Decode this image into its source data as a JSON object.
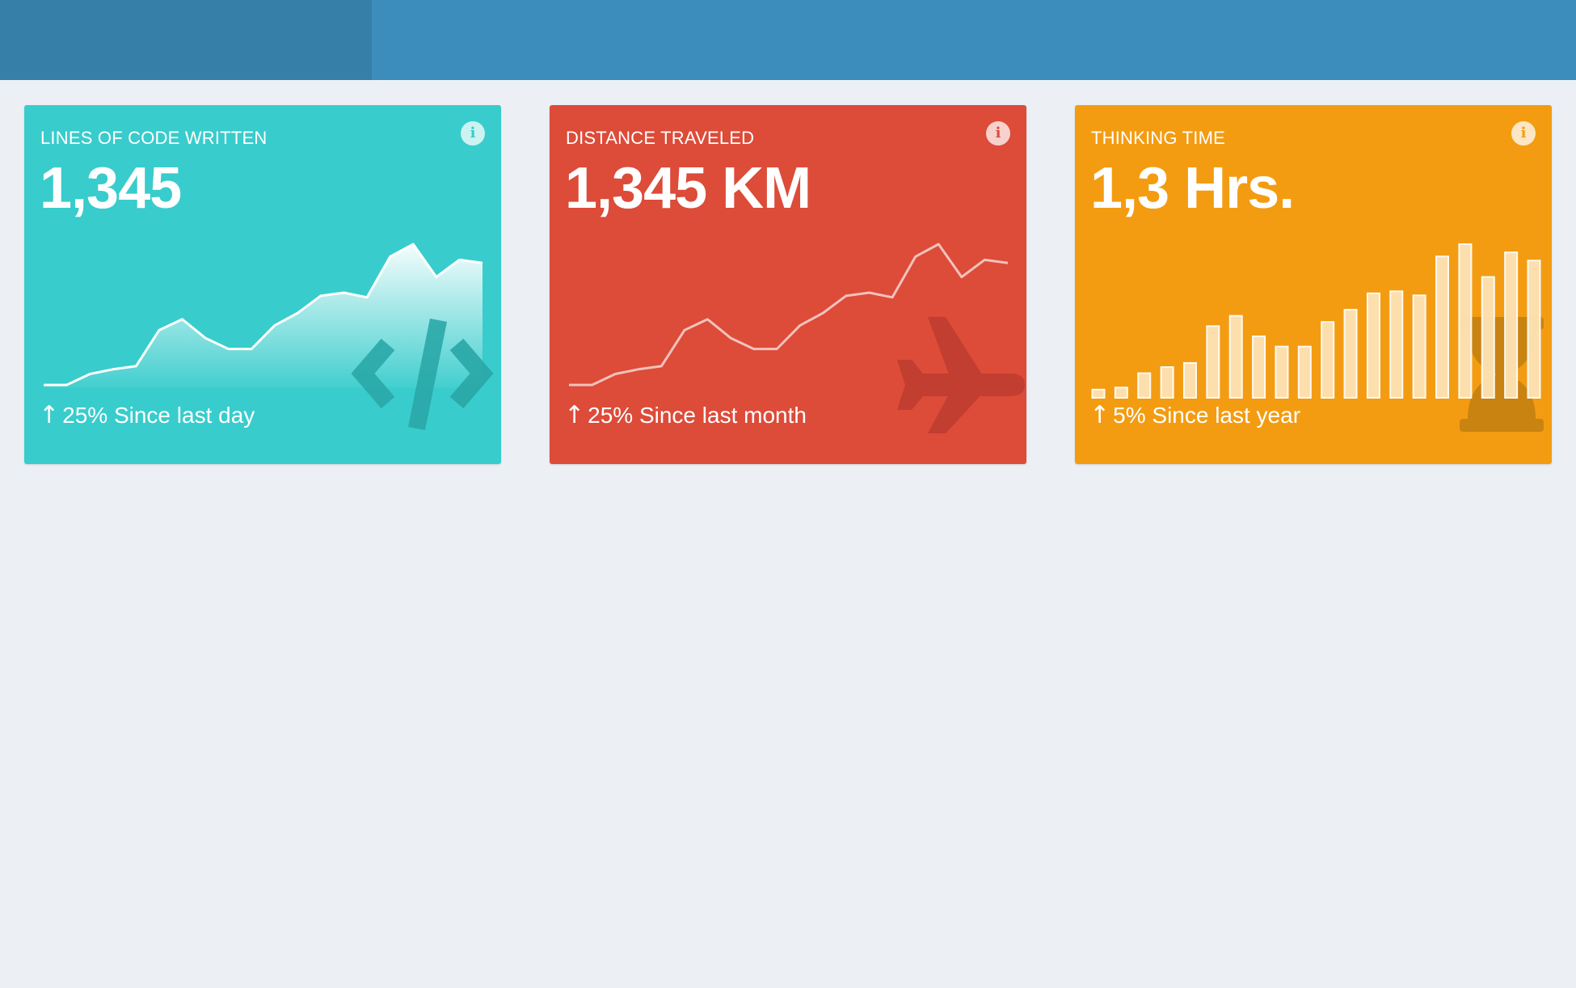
{
  "colors": {
    "topbar": "#3c8dbc",
    "brand": "#367fa9",
    "background": "#ecf0f4",
    "teal": "#39cccc",
    "red": "#dd4b39",
    "orange": "#f39c12"
  },
  "cards": [
    {
      "title": "LINES OF CODE WRITTEN",
      "value": "1,345",
      "change_arrow": "↑",
      "change_text": "25% Since last day",
      "bg_icon": "code-icon",
      "info_icon": "info-icon",
      "color": "#39cccc"
    },
    {
      "title": "DISTANCE TRAVELED",
      "value": "1,345 KM",
      "change_arrow": "↑",
      "change_text": "25% Since last month",
      "bg_icon": "plane-icon",
      "info_icon": "info-icon",
      "color": "#dd4b39"
    },
    {
      "title": "THINKING TIME",
      "value": "1,3 Hrs.",
      "change_arrow": "↑",
      "change_text": "5% Since last year",
      "bg_icon": "hourglass-icon",
      "info_icon": "info-icon",
      "color": "#f39c12"
    }
  ],
  "chart_data": [
    {
      "type": "area",
      "values": [
        2,
        2,
        9,
        12,
        14,
        37,
        44,
        32,
        25,
        25,
        40,
        48,
        59,
        61,
        58,
        84,
        92,
        71,
        82,
        80
      ]
    },
    {
      "type": "line",
      "values": [
        2,
        2,
        9,
        12,
        14,
        37,
        44,
        32,
        25,
        25,
        40,
        48,
        59,
        61,
        58,
        84,
        92,
        71,
        82,
        80
      ]
    },
    {
      "type": "bar",
      "values": [
        4,
        5,
        12,
        15,
        17,
        35,
        40,
        30,
        25,
        25,
        37,
        43,
        51,
        52,
        50,
        69,
        75,
        59,
        71,
        67
      ]
    }
  ]
}
